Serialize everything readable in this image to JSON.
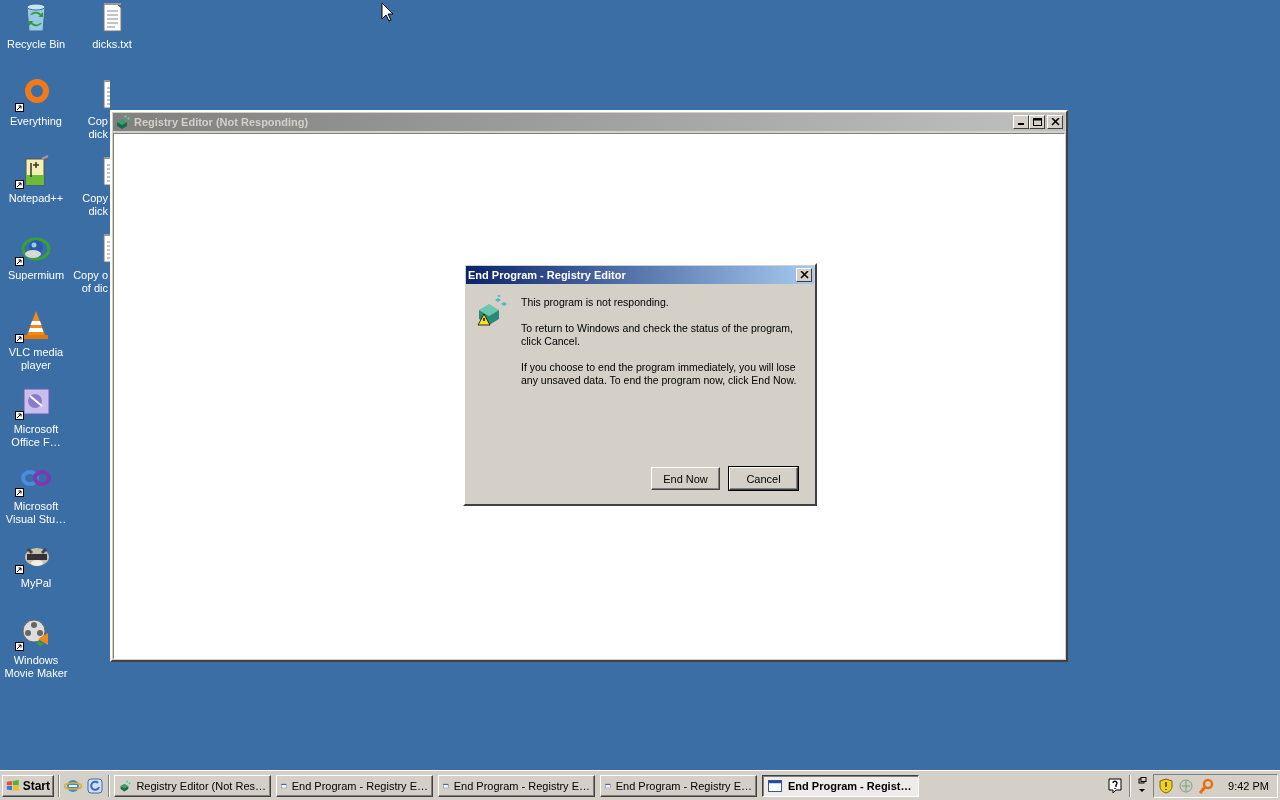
{
  "desktop": {
    "icons": [
      {
        "kind": "recycle",
        "lines": [
          "Recycle Bin"
        ],
        "shortcut": false,
        "cut": false
      },
      {
        "kind": "ring",
        "lines": [
          "Everything"
        ],
        "shortcut": true,
        "cut": false
      },
      {
        "kind": "notepad",
        "lines": [
          "Notepad++"
        ],
        "shortcut": true,
        "cut": false
      },
      {
        "kind": "globe",
        "lines": [
          "Supermium"
        ],
        "shortcut": true,
        "cut": false
      },
      {
        "kind": "cone",
        "lines": [
          "VLC media",
          "player"
        ],
        "shortcut": true,
        "cut": false
      },
      {
        "kind": "office",
        "lines": [
          "Microsoft",
          "Office F…"
        ],
        "shortcut": true,
        "cut": false
      },
      {
        "kind": "loops",
        "lines": [
          "Microsoft",
          "Visual Stu…"
        ],
        "shortcut": true,
        "cut": false
      },
      {
        "kind": "animal",
        "lines": [
          "MyPal"
        ],
        "shortcut": true,
        "cut": false
      },
      {
        "kind": "reel",
        "lines": [
          "Windows",
          "Movie Maker"
        ],
        "shortcut": true,
        "cut": false
      },
      {
        "kind": "doc",
        "lines": [
          "dicks.txt"
        ],
        "shortcut": false,
        "cut": false
      },
      {
        "kind": "doc",
        "lines": [
          "Cop",
          "dick"
        ],
        "shortcut": false,
        "cut": true
      },
      {
        "kind": "doc",
        "lines": [
          "Copy",
          "dick"
        ],
        "shortcut": false,
        "cut": true
      },
      {
        "kind": "doc",
        "lines": [
          "Copy o",
          "of dic"
        ],
        "shortcut": false,
        "cut": true
      }
    ]
  },
  "main_window": {
    "title": "Registry Editor (Not Responding)",
    "active": false
  },
  "dialog": {
    "title": "End Program - Registry Editor",
    "active": true,
    "messages": [
      "This program is not responding.",
      "To return to Windows and check the status of the program, click Cancel.",
      "If you choose to end the program immediately, you will lose any unsaved data. To end the program now, click End Now."
    ],
    "buttons": [
      {
        "label": "End Now",
        "default": false
      },
      {
        "label": "Cancel",
        "default": true
      }
    ]
  },
  "taskbar": {
    "start": "Start",
    "tasks": [
      {
        "label": "Registry Editor (Not Res…",
        "kind": "regedit",
        "selected": false
      },
      {
        "label": "End Program - Registry E…",
        "kind": "window",
        "selected": false
      },
      {
        "label": "End Program - Registry E…",
        "kind": "window",
        "selected": false
      },
      {
        "label": "End Program - Registry E…",
        "kind": "window",
        "selected": false
      },
      {
        "label": "End Program - Regist…",
        "kind": "window",
        "selected": true
      }
    ],
    "clock": "9:42 PM"
  }
}
